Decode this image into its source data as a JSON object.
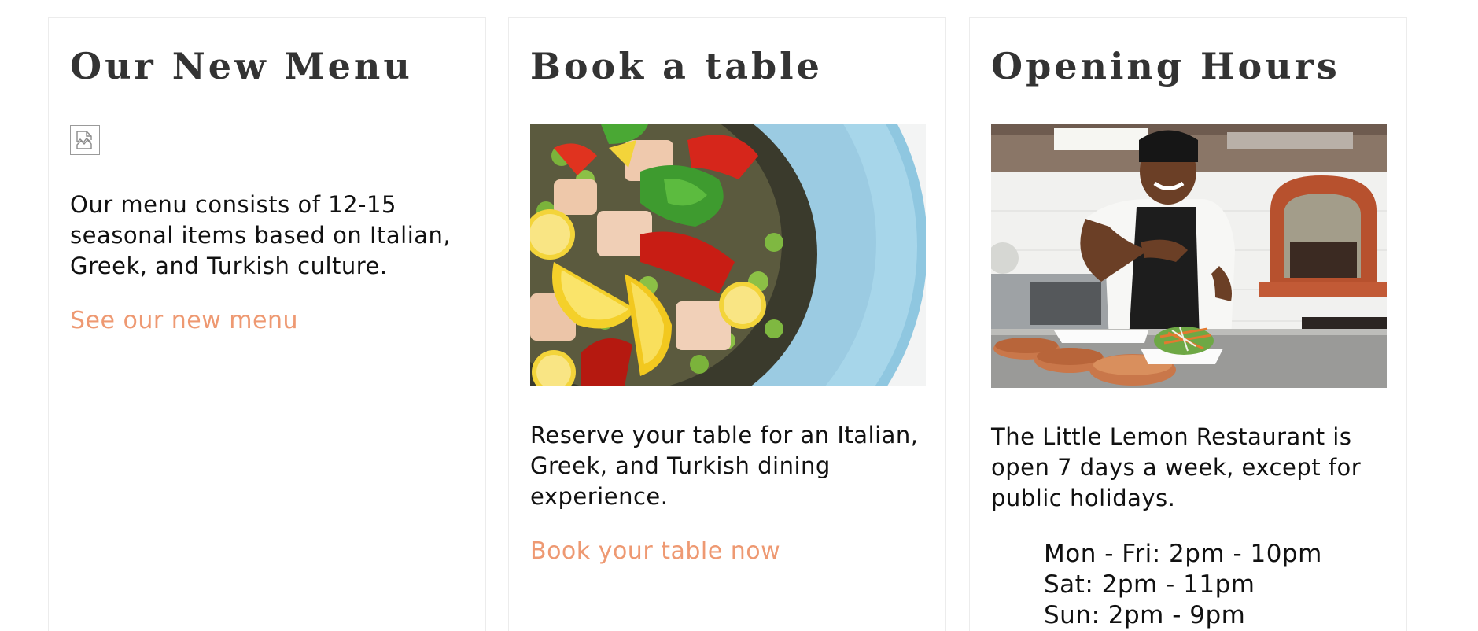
{
  "cards": [
    {
      "title": "Our New Menu",
      "description": "Our menu consists of 12-15 seasonal items based on Italian, Greek, and Turkish culture.",
      "link": "See our new menu",
      "image": "broken-image-icon"
    },
    {
      "title": "Book a table",
      "description": "Reserve your table for an Italian, Greek, and Turkish dining experience.",
      "link": "Book your table now",
      "image": "salad-photo"
    },
    {
      "title": "Opening Hours",
      "description": "The Little Lemon Restaurant is open 7 days a week, except for public holidays.",
      "hours": [
        "Mon - Fri: 2pm - 10pm",
        "Sat: 2pm - 11pm",
        "Sun: 2pm - 9pm"
      ],
      "image": "chef-photo"
    }
  ],
  "colors": {
    "link": "#ee9972",
    "heading": "#333333",
    "border": "#ececec"
  }
}
